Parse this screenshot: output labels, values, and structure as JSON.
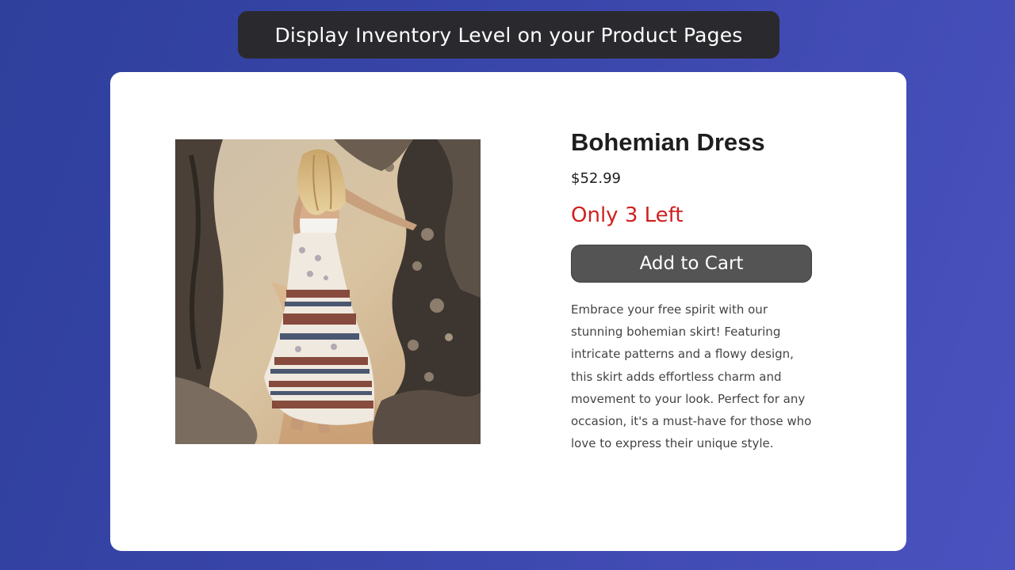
{
  "banner": {
    "text": "Display Inventory Level on your Product Pages"
  },
  "product": {
    "name": "Bohemian Dress",
    "price": "$52.99",
    "stock_text": "Only 3 Left",
    "add_to_cart_label": "Add to Cart",
    "description": "Embrace your free spirit with our stunning bohemian skirt! Featuring intricate patterns and a flowy design, this skirt adds effortless charm and movement to your look. Perfect for any occasion, it's a must-have for those who love to express their unique style."
  },
  "colors": {
    "background_start": "#2e3f9c",
    "background_end": "#4a52bf",
    "banner_bg": "#2a2a2e",
    "stock_red": "#d11f1f",
    "button_bg": "#545454"
  }
}
